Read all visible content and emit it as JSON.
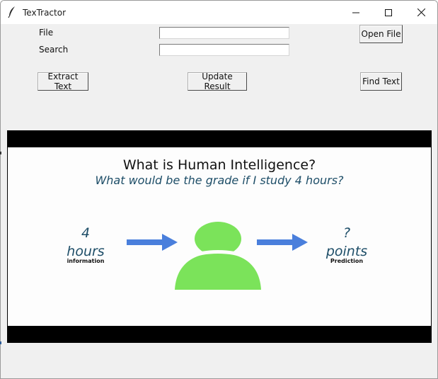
{
  "window": {
    "title": "TexTractor"
  },
  "form": {
    "file_label": "File",
    "search_label": "Search",
    "file_value": "",
    "search_value": ""
  },
  "buttons": {
    "open_file": "Open File",
    "extract_text": "Extract Text",
    "update_result": "Update Result",
    "find_text": "Find Text"
  },
  "image": {
    "title": "What is Human Intelligence?",
    "subtitle": "What would be the grade if I study 4 hours?",
    "input_value": "4",
    "input_unit": "hours",
    "input_caption": "information",
    "output_value": "?",
    "output_unit": "points",
    "output_caption": "Prediction"
  },
  "icons": [
    "feather-icon",
    "minimize-icon",
    "maximize-icon",
    "close-icon",
    "arrow-right-icon",
    "person-icon"
  ],
  "colors": {
    "arrow": "#4a7fdc",
    "person": "#7be35a",
    "slide_text": "#1e4e68"
  }
}
